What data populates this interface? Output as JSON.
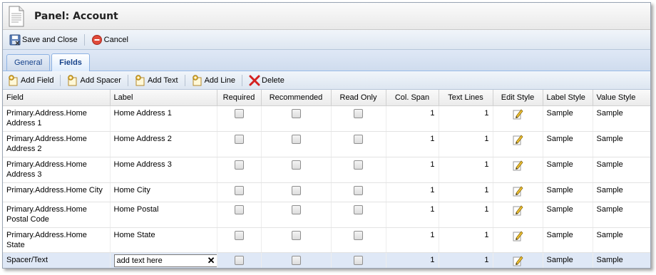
{
  "window": {
    "title": "Panel: Account"
  },
  "toolbar": {
    "save_close_label": "Save and Close",
    "cancel_label": "Cancel"
  },
  "tabs": [
    {
      "label": "General",
      "active": false
    },
    {
      "label": "Fields",
      "active": true
    }
  ],
  "field_toolbar": {
    "add_field": "Add Field",
    "add_spacer": "Add Spacer",
    "add_text": "Add Text",
    "add_line": "Add Line",
    "delete": "Delete"
  },
  "grid": {
    "columns": [
      "Field",
      "Label",
      "Required",
      "Recommended",
      "Read Only",
      "Col. Span",
      "Text Lines",
      "Edit Style",
      "Label Style",
      "Value Style"
    ],
    "rows": [
      {
        "field": "Primary.Address.Home Address 1",
        "label": "Home Address 1",
        "required": false,
        "recommended": false,
        "read_only": false,
        "col_span": "1",
        "text_lines": "1",
        "label_style": "Sample",
        "value_style": "Sample"
      },
      {
        "field": "Primary.Address.Home Address 2",
        "label": "Home Address 2",
        "required": false,
        "recommended": false,
        "read_only": false,
        "col_span": "1",
        "text_lines": "1",
        "label_style": "Sample",
        "value_style": "Sample"
      },
      {
        "field": "Primary.Address.Home Address 3",
        "label": "Home Address 3",
        "required": false,
        "recommended": false,
        "read_only": false,
        "col_span": "1",
        "text_lines": "1",
        "label_style": "Sample",
        "value_style": "Sample"
      },
      {
        "field": "Primary.Address.Home City",
        "label": "Home City",
        "required": false,
        "recommended": false,
        "read_only": false,
        "col_span": "1",
        "text_lines": "1",
        "label_style": "Sample",
        "value_style": "Sample"
      },
      {
        "field": "Primary.Address.Home Postal Code",
        "label": "Home Postal",
        "required": false,
        "recommended": false,
        "read_only": false,
        "col_span": "1",
        "text_lines": "1",
        "label_style": "Sample",
        "value_style": "Sample"
      },
      {
        "field": "Primary.Address.Home State",
        "label": "Home State",
        "required": false,
        "recommended": false,
        "read_only": false,
        "col_span": "1",
        "text_lines": "1",
        "label_style": "Sample",
        "value_style": "Sample"
      },
      {
        "field": "Spacer/Text",
        "label_input_value": "add text here",
        "required": false,
        "recommended": false,
        "read_only": false,
        "col_span": "1",
        "text_lines": "1",
        "label_style": "Sample",
        "value_style": "Sample",
        "selected": true
      }
    ]
  },
  "icons": {
    "document": "document-icon",
    "save": "save-icon",
    "cancel": "cancel-icon",
    "add": "add-icon",
    "delete": "delete-icon",
    "edit": "pencil-edit-icon"
  },
  "colors": {
    "tab_text": "#15428b",
    "selected_row": "#dfe8f6",
    "delete_red": "#d42020",
    "cancel_red": "#e04a3a"
  }
}
